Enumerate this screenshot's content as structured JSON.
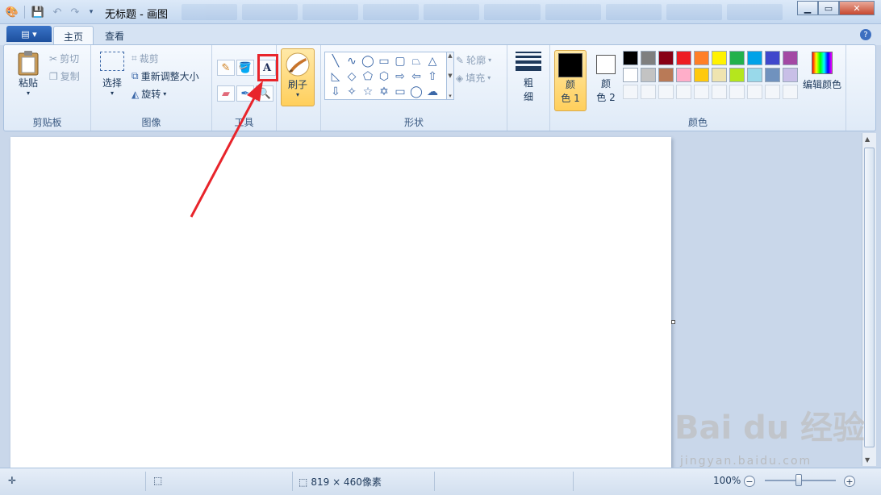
{
  "title": "无标题 - 画图",
  "tabs": {
    "home": "主页",
    "view": "查看"
  },
  "clipboard": {
    "paste": "粘贴",
    "cut": "剪切",
    "copy": "复制",
    "label": "剪贴板"
  },
  "image": {
    "select": "选择",
    "crop": "裁剪",
    "resize": "重新调整大小",
    "rotate": "旋转",
    "label": "图像"
  },
  "tools": {
    "label": "工具",
    "brush": "刷子"
  },
  "shapes": {
    "outline": "轮廓",
    "fill": "填充",
    "label": "形状"
  },
  "size": {
    "label_line1": "粗",
    "label_line2": "细"
  },
  "colors": {
    "color1_line1": "颜",
    "color1_line2": "色 1",
    "color2_line1": "颜",
    "color2_line2": "色 2",
    "edit": "编辑颜色",
    "label": "颜色",
    "color1": "#000000",
    "color2": "#ffffff",
    "palette_row1": [
      "#000000",
      "#7f7f7f",
      "#880015",
      "#ed1c24",
      "#ff7f27",
      "#fff200",
      "#22b14c",
      "#00a2e8",
      "#3f48cc",
      "#a349a4"
    ],
    "palette_row2": [
      "#ffffff",
      "#c3c3c3",
      "#b97a57",
      "#ffaec9",
      "#ffc90e",
      "#efe4b0",
      "#b5e61d",
      "#99d9ea",
      "#7092be",
      "#c8bfe7"
    ]
  },
  "status": {
    "dimensions": "819 × 460像素",
    "zoom": "100%"
  },
  "watermark": {
    "brand": "Bai du 经验",
    "url": "jingyan.baidu.com"
  }
}
